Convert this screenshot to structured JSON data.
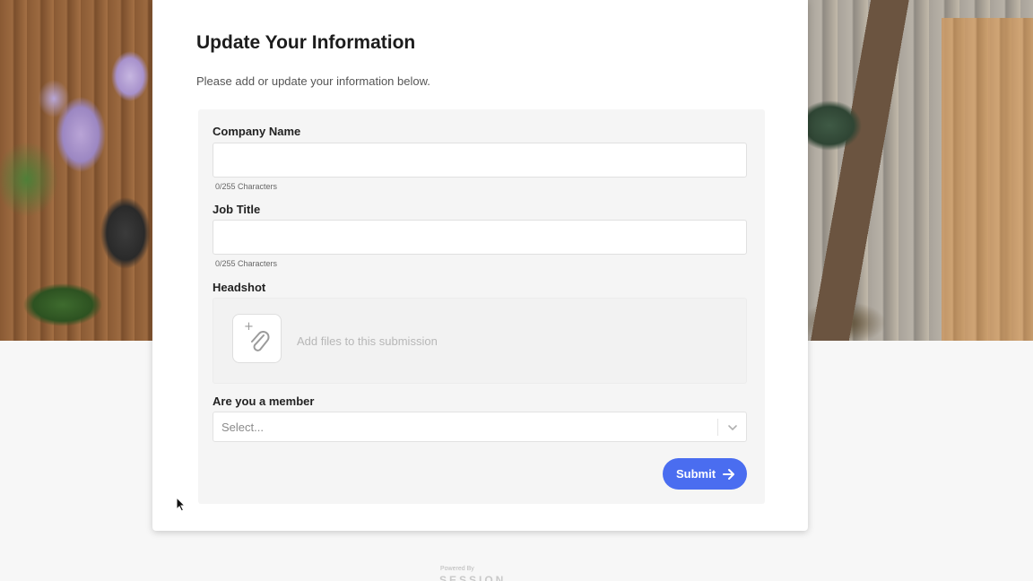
{
  "form": {
    "title": "Update Your Information",
    "subtitle": "Please add or update your information below.",
    "company": {
      "label": "Company Name",
      "value": "",
      "counter": "0/255 Characters"
    },
    "job_title": {
      "label": "Job Title",
      "value": "",
      "counter": "0/255 Characters"
    },
    "headshot": {
      "label": "Headshot",
      "upload_text": "Add files to this submission",
      "icon": "paperclip-icon"
    },
    "member": {
      "label": "Are you a member",
      "placeholder": "Select...",
      "icon": "chevron-down-icon"
    },
    "submit_label": "Submit",
    "submit_icon": "arrow-right-icon"
  },
  "footer": {
    "powered_by": "Powered By",
    "brand": "SESSION"
  },
  "colors": {
    "accent": "#4a6df0",
    "card": "#ffffff",
    "panel": "#f5f5f5",
    "page_background": "#f7f7f7"
  }
}
